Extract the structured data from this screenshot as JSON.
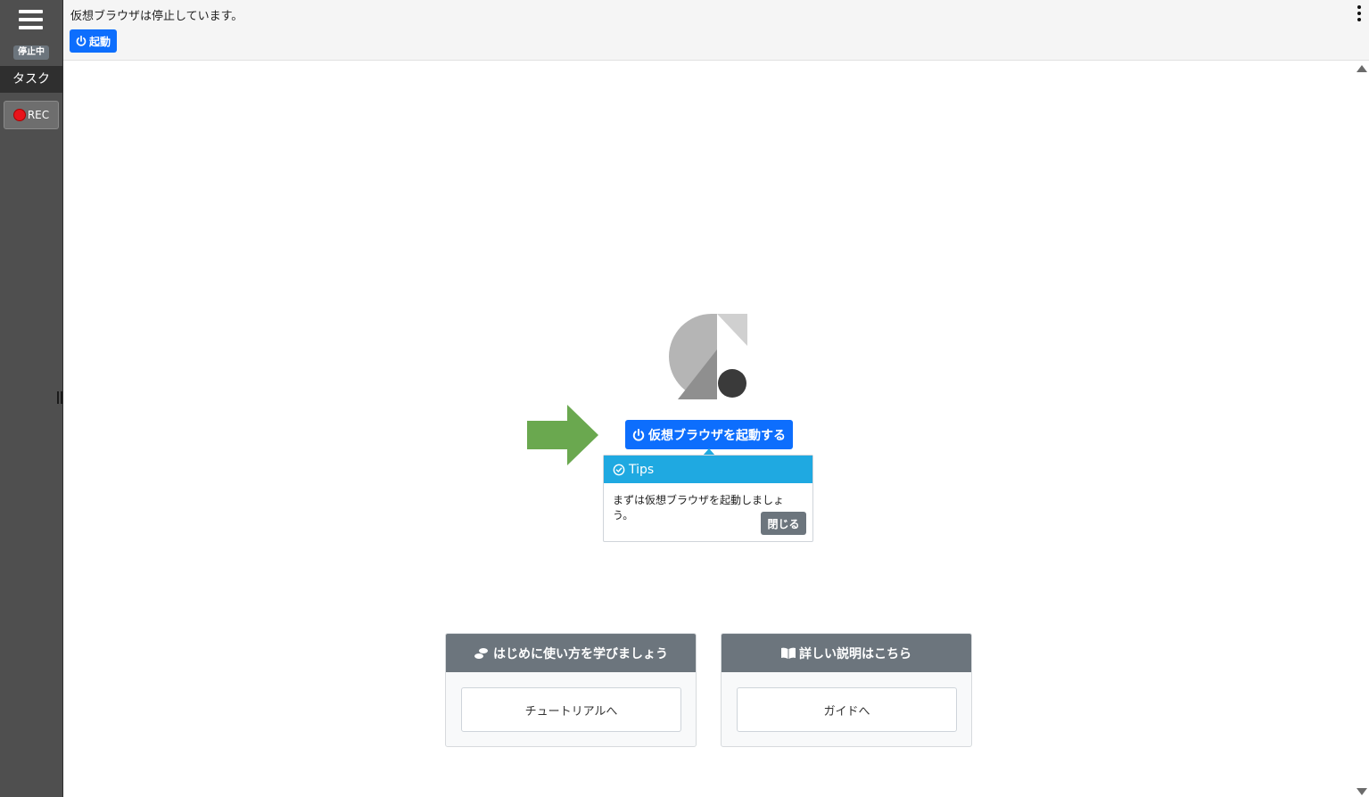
{
  "sidebar": {
    "status_badge": "停止中",
    "task_tab": "タスク",
    "rec_label": "REC"
  },
  "topbar": {
    "status_text": "仮想ブラウザは停止しています。",
    "start_label": "起動"
  },
  "main": {
    "launch_label": "仮想ブラウザを起動する",
    "tips": {
      "title": "Tips",
      "message": "まずは仮想ブラウザを起動しましょう。",
      "close_label": "閉じる"
    },
    "cards": [
      {
        "header": "はじめに使い方を学びましょう",
        "button": "チュートリアルへ"
      },
      {
        "header": "詳しい説明はこちら",
        "button": "ガイドへ"
      }
    ]
  },
  "colors": {
    "primary": "#0d6efd",
    "tips_header": "#1fa9e1",
    "secondary": "#6c757d",
    "sidebar": "#4f4f4f",
    "arrow": "#6aa84f",
    "rec": "#e8141b"
  },
  "icons": [
    "menu-icon",
    "power-icon",
    "kebab-menu-icon",
    "check-circle-icon",
    "footprints-icon",
    "book-icon",
    "record-dot-icon"
  ]
}
